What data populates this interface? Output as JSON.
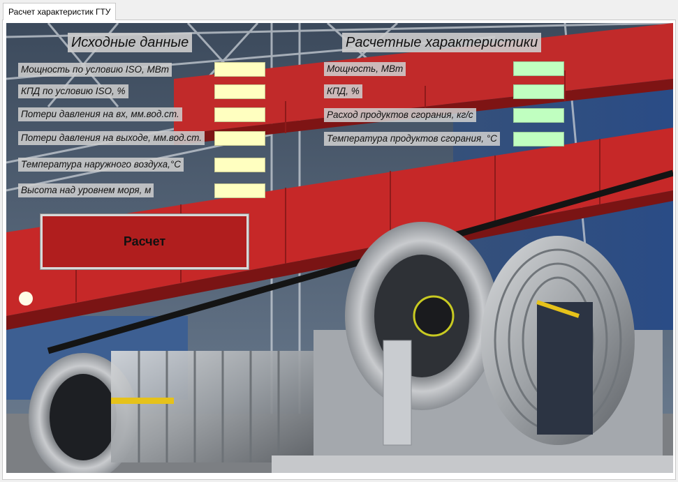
{
  "window": {
    "tab_title": "Расчет характеристик ГТУ"
  },
  "input_section": {
    "title": "Исходные данные",
    "fields": [
      {
        "label": "Мощность по условию ISO, МВт",
        "value": ""
      },
      {
        "label": "КПД по условию ISO, %",
        "value": ""
      },
      {
        "label": "Потери давления на вх, мм.вод.ст.",
        "value": ""
      },
      {
        "label": "Потери давления на выходе, мм.вод.ст.",
        "value": ""
      },
      {
        "label": "Температура наружного воздуха,°С",
        "value": ""
      },
      {
        "label": "Высота над уровнем моря, м",
        "value": ""
      }
    ]
  },
  "output_section": {
    "title": "Расчетные характеристики",
    "fields": [
      {
        "label": "Мощность, МВт",
        "value": ""
      },
      {
        "label": "КПД, %",
        "value": ""
      },
      {
        "label": "Расход продуктов сгорания, кг/с",
        "value": ""
      },
      {
        "label": "Температура продуктов сгорания, °С",
        "value": ""
      }
    ]
  },
  "calc_button": {
    "label": "Расчет"
  },
  "colors": {
    "input_field": "#ffffc0",
    "output_field": "#c0ffc0",
    "button": "#b01e1e",
    "beam_red": "#c62828"
  },
  "background": {
    "icon": "gas-turbine-factory-photo"
  }
}
